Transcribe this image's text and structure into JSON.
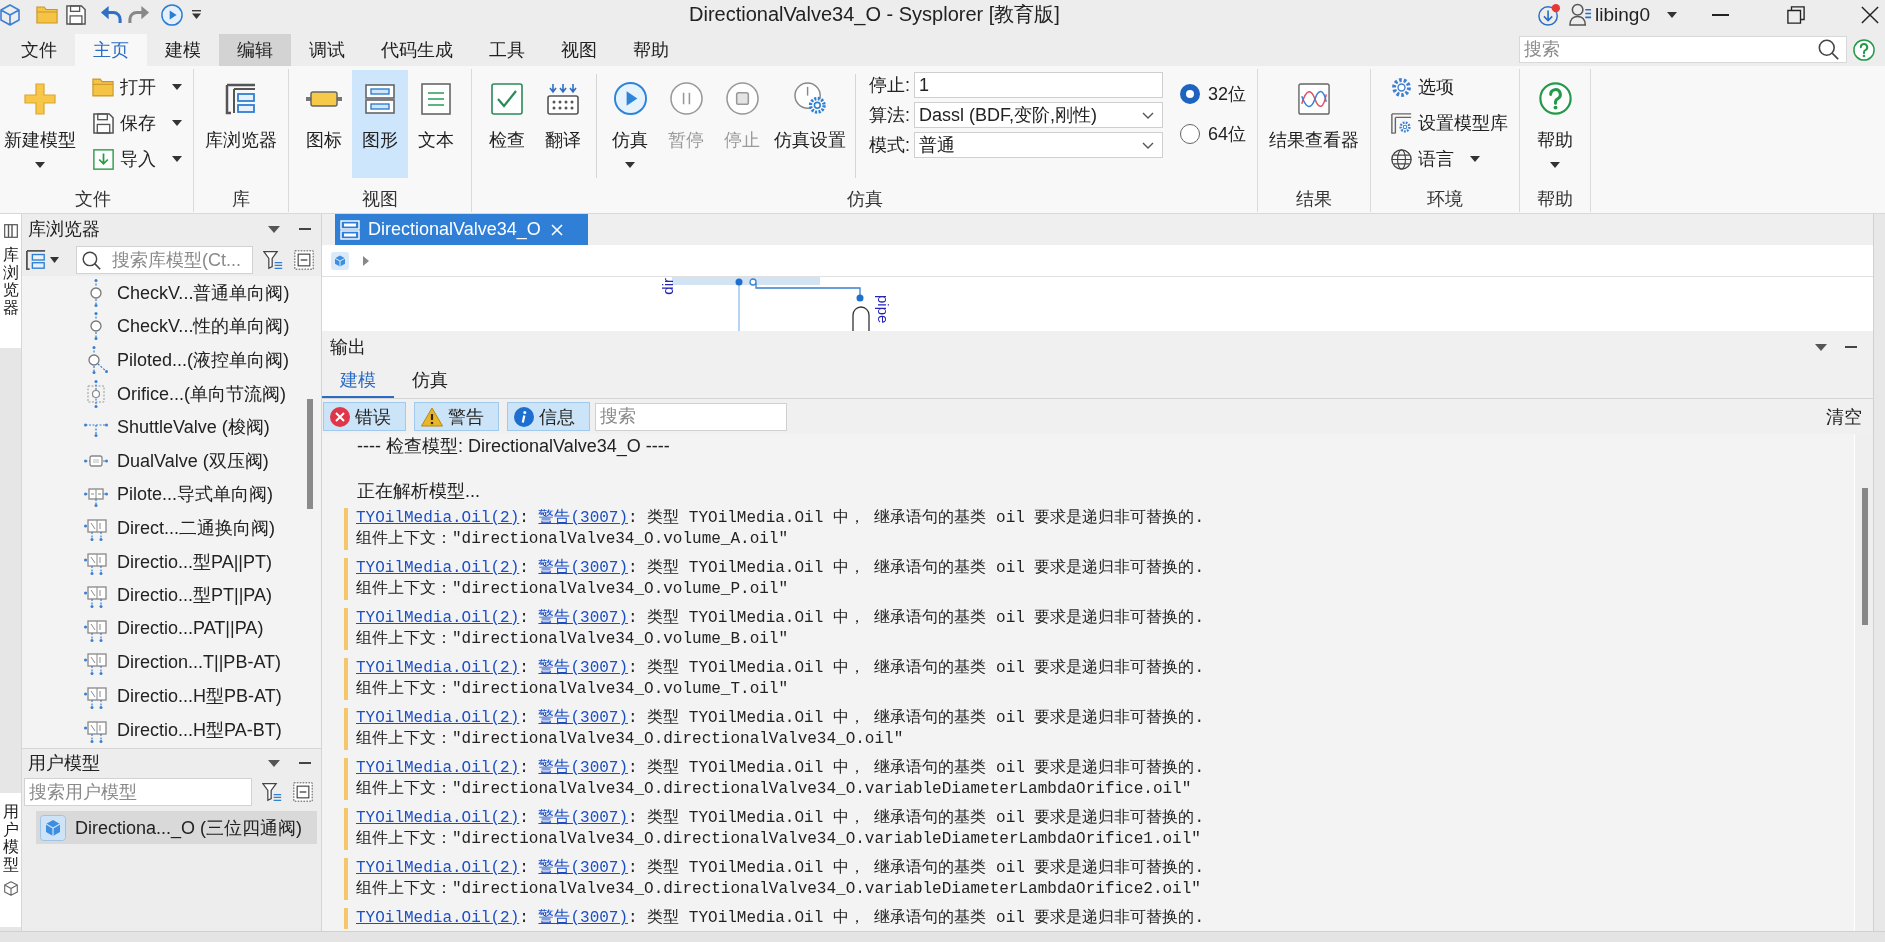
{
  "title_bar": {
    "title": "DirectionalValve34_O - Sysplorer [教育版]",
    "user": "libing0"
  },
  "menu": {
    "tabs": [
      {
        "label": "文件",
        "selected": false,
        "hovered": false
      },
      {
        "label": "主页",
        "selected": true,
        "hovered": false
      },
      {
        "label": "建模",
        "selected": false,
        "hovered": false
      },
      {
        "label": "编辑",
        "selected": false,
        "hovered": true
      },
      {
        "label": "调试",
        "selected": false,
        "hovered": false
      },
      {
        "label": "代码生成",
        "selected": false,
        "hovered": false
      },
      {
        "label": "工具",
        "selected": false,
        "hovered": false
      },
      {
        "label": "视图",
        "selected": false,
        "hovered": false
      },
      {
        "label": "帮助",
        "selected": false,
        "hovered": false
      }
    ],
    "search": {
      "placeholder": "搜索"
    }
  },
  "ribbon": {
    "groups": [
      {
        "label": "文件",
        "items": [
          {
            "kind": "large",
            "label": "新建模型",
            "dropdown": true,
            "selected": false,
            "disabled": false
          },
          {
            "kind": "small",
            "label": "打开",
            "dropdown": true,
            "selected": false,
            "disabled": false
          },
          {
            "kind": "small",
            "label": "保存",
            "dropdown": true,
            "selected": false,
            "disabled": false
          },
          {
            "kind": "small",
            "label": "导入",
            "dropdown": true,
            "selected": false,
            "disabled": false
          }
        ]
      },
      {
        "label": "库",
        "items": [
          {
            "kind": "large",
            "label": "库浏览器",
            "dropdown": false,
            "selected": false,
            "disabled": false
          }
        ]
      },
      {
        "label": "视图",
        "items": [
          {
            "kind": "large",
            "label": "图标",
            "dropdown": false,
            "selected": false,
            "disabled": false
          },
          {
            "kind": "large",
            "label": "图形",
            "dropdown": false,
            "selected": true,
            "disabled": false
          },
          {
            "kind": "large",
            "label": "文本",
            "dropdown": false,
            "selected": false,
            "disabled": false
          }
        ]
      },
      {
        "label": "仿真",
        "items": [
          {
            "kind": "large",
            "label": "检查",
            "dropdown": false,
            "selected": false,
            "disabled": false
          },
          {
            "kind": "large",
            "label": "翻译",
            "dropdown": false,
            "selected": false,
            "disabled": false
          },
          {
            "kind": "separator"
          },
          {
            "kind": "large",
            "label": "仿真",
            "dropdown": true,
            "selected": false,
            "disabled": false
          },
          {
            "kind": "large",
            "label": "暂停",
            "dropdown": false,
            "selected": false,
            "disabled": true
          },
          {
            "kind": "large",
            "label": "停止",
            "dropdown": false,
            "selected": false,
            "disabled": true
          },
          {
            "kind": "large",
            "label": "仿真设置",
            "dropdown": false,
            "selected": false,
            "disabled": false
          },
          {
            "kind": "separator"
          },
          {
            "kind": "field",
            "label": "停止:",
            "value": "1"
          },
          {
            "kind": "select",
            "label": "算法:",
            "value": "Dassl (BDF,变阶,刚性)"
          },
          {
            "kind": "select",
            "label": "模式:",
            "value": "普通"
          },
          {
            "kind": "radio",
            "label": "32位",
            "selected": true
          },
          {
            "kind": "radio",
            "label": "64位",
            "selected": false
          }
        ]
      },
      {
        "label": "结果",
        "items": [
          {
            "kind": "large",
            "label": "结果查看器",
            "dropdown": false,
            "selected": false,
            "disabled": false
          }
        ]
      },
      {
        "label": "环境",
        "items": [
          {
            "kind": "small",
            "label": "选项",
            "dropdown": false,
            "selected": false,
            "disabled": false
          },
          {
            "kind": "small",
            "label": "设置模型库",
            "dropdown": false,
            "selected": false,
            "disabled": false
          },
          {
            "kind": "small",
            "label": "语言",
            "dropdown": true,
            "selected": false,
            "disabled": false
          }
        ]
      },
      {
        "label": "帮助",
        "items": [
          {
            "kind": "large",
            "label": "帮助",
            "dropdown": true,
            "selected": false,
            "disabled": false
          }
        ]
      }
    ]
  },
  "side_tabs": [
    {
      "label": "库浏览器"
    },
    {
      "label": "用户模型"
    }
  ],
  "library_browser": {
    "title": "库浏览器",
    "search": {
      "placeholder": "搜索库模型(Ct..."
    },
    "items": [
      {
        "kind": "check",
        "label": "CheckV...普通单向阀)",
        "selected": false
      },
      {
        "kind": "check",
        "label": "CheckV...性的单向阀)",
        "selected": false
      },
      {
        "kind": "pilot-check",
        "label": "Piloted...(液控单向阀)",
        "selected": false
      },
      {
        "kind": "orifice",
        "label": "Orifice...(单向节流阀)",
        "selected": false
      },
      {
        "kind": "shuttle",
        "label": "ShuttleValve (梭阀)",
        "selected": false
      },
      {
        "kind": "dual",
        "label": "DualValve (双压阀)",
        "selected": false
      },
      {
        "kind": "pilot",
        "label": "Pilote...导式单向阀)",
        "selected": false
      },
      {
        "kind": "directional",
        "label": "Direct...二通换向阀)",
        "selected": false
      },
      {
        "kind": "directional",
        "label": "Directio...型PA||PT)",
        "selected": false
      },
      {
        "kind": "directional",
        "label": "Directio...型PT||PA)",
        "selected": false
      },
      {
        "kind": "directional",
        "label": "Directio...PAT||PA)",
        "selected": false
      },
      {
        "kind": "directional",
        "label": "Direction...T||PB-AT)",
        "selected": false
      },
      {
        "kind": "directional",
        "label": "Directio...H型PB-AT)",
        "selected": false
      },
      {
        "kind": "directional",
        "label": "Directio...H型PA-BT)",
        "selected": false
      }
    ]
  },
  "user_models": {
    "title": "用户模型",
    "search": {
      "placeholder": "搜索用户模型"
    },
    "items": [
      {
        "label": "Directiona..._O (三位四通阀)",
        "selected": true
      }
    ]
  },
  "document": {
    "tabs": [
      {
        "label": "DirectionalValve34_O",
        "selected": true
      }
    ],
    "diagram": {
      "labels": [
        {
          "text": "dir"
        },
        {
          "text": "pipe"
        }
      ]
    }
  },
  "output": {
    "title": "输出",
    "tabs": [
      {
        "label": "建模",
        "selected": true
      },
      {
        "label": "仿真",
        "selected": false
      }
    ],
    "filters": [
      {
        "kind": "error",
        "label": "错误",
        "checked": true
      },
      {
        "kind": "warning",
        "label": "警告",
        "checked": true
      },
      {
        "kind": "info",
        "label": "信息",
        "checked": true
      }
    ],
    "search": {
      "placeholder": "搜索"
    },
    "clear": "清空",
    "log": [
      {
        "kind": "text",
        "text": "---- 检查模型: DirectionalValve34_O ----"
      },
      {
        "kind": "text",
        "text": "正在解析模型..."
      },
      {
        "kind": "warning",
        "segments": [
          {
            "kind": "link",
            "text": "TYOilMedia.Oil(2)"
          },
          {
            "kind": "text",
            "text": ": "
          },
          {
            "kind": "link",
            "text": "警告(3007)"
          },
          {
            "kind": "text",
            "text": ": 类型 TYOilMedia.Oil 中， 继承语句的基类 oil 要求是递归非可替换的."
          }
        ],
        "context": "组件上下文：\"directionalValve34_O.volume_A.oil\""
      },
      {
        "kind": "warning",
        "segments": [
          {
            "kind": "link",
            "text": "TYOilMedia.Oil(2)"
          },
          {
            "kind": "text",
            "text": ": "
          },
          {
            "kind": "link",
            "text": "警告(3007)"
          },
          {
            "kind": "text",
            "text": ": 类型 TYOilMedia.Oil 中， 继承语句的基类 oil 要求是递归非可替换的."
          }
        ],
        "context": "组件上下文：\"directionalValve34_O.volume_P.oil\""
      },
      {
        "kind": "warning",
        "segments": [
          {
            "kind": "link",
            "text": "TYOilMedia.Oil(2)"
          },
          {
            "kind": "text",
            "text": ": "
          },
          {
            "kind": "link",
            "text": "警告(3007)"
          },
          {
            "kind": "text",
            "text": ": 类型 TYOilMedia.Oil 中， 继承语句的基类 oil 要求是递归非可替换的."
          }
        ],
        "context": "组件上下文：\"directionalValve34_O.volume_B.oil\""
      },
      {
        "kind": "warning",
        "segments": [
          {
            "kind": "link",
            "text": "TYOilMedia.Oil(2)"
          },
          {
            "kind": "text",
            "text": ": "
          },
          {
            "kind": "link",
            "text": "警告(3007)"
          },
          {
            "kind": "text",
            "text": ": 类型 TYOilMedia.Oil 中， 继承语句的基类 oil 要求是递归非可替换的."
          }
        ],
        "context": "组件上下文：\"directionalValve34_O.volume_T.oil\""
      },
      {
        "kind": "warning",
        "segments": [
          {
            "kind": "link",
            "text": "TYOilMedia.Oil(2)"
          },
          {
            "kind": "text",
            "text": ": "
          },
          {
            "kind": "link",
            "text": "警告(3007)"
          },
          {
            "kind": "text",
            "text": ": 类型 TYOilMedia.Oil 中， 继承语句的基类 oil 要求是递归非可替换的."
          }
        ],
        "context": "组件上下文：\"directionalValve34_O.directionalValve34_O.oil\""
      },
      {
        "kind": "warning",
        "segments": [
          {
            "kind": "link",
            "text": "TYOilMedia.Oil(2)"
          },
          {
            "kind": "text",
            "text": ": "
          },
          {
            "kind": "link",
            "text": "警告(3007)"
          },
          {
            "kind": "text",
            "text": ": 类型 TYOilMedia.Oil 中， 继承语句的基类 oil 要求是递归非可替换的."
          }
        ],
        "context": "组件上下文：\"directionalValve34_O.directionalValve34_O.variableDiameterLambdaOrifice.oil\""
      },
      {
        "kind": "warning",
        "segments": [
          {
            "kind": "link",
            "text": "TYOilMedia.Oil(2)"
          },
          {
            "kind": "text",
            "text": ": "
          },
          {
            "kind": "link",
            "text": "警告(3007)"
          },
          {
            "kind": "text",
            "text": ": 类型 TYOilMedia.Oil 中， 继承语句的基类 oil 要求是递归非可替换的."
          }
        ],
        "context": "组件上下文：\"directionalValve34_O.directionalValve34_O.variableDiameterLambdaOrifice1.oil\""
      },
      {
        "kind": "warning",
        "segments": [
          {
            "kind": "link",
            "text": "TYOilMedia.Oil(2)"
          },
          {
            "kind": "text",
            "text": ": "
          },
          {
            "kind": "link",
            "text": "警告(3007)"
          },
          {
            "kind": "text",
            "text": ": 类型 TYOilMedia.Oil 中， 继承语句的基类 oil 要求是递归非可替换的."
          }
        ],
        "context": "组件上下文：\"directionalValve34_O.directionalValve34_O.variableDiameterLambdaOrifice2.oil\""
      },
      {
        "kind": "warning",
        "segments": [
          {
            "kind": "link",
            "text": "TYOilMedia.Oil(2)"
          },
          {
            "kind": "text",
            "text": ": "
          },
          {
            "kind": "link",
            "text": "警告(3007)"
          },
          {
            "kind": "text",
            "text": ": 类型 TYOilMedia.Oil 中， 继承语句的基类 oil 要求是递归非可替换的."
          }
        ]
      }
    ]
  }
}
